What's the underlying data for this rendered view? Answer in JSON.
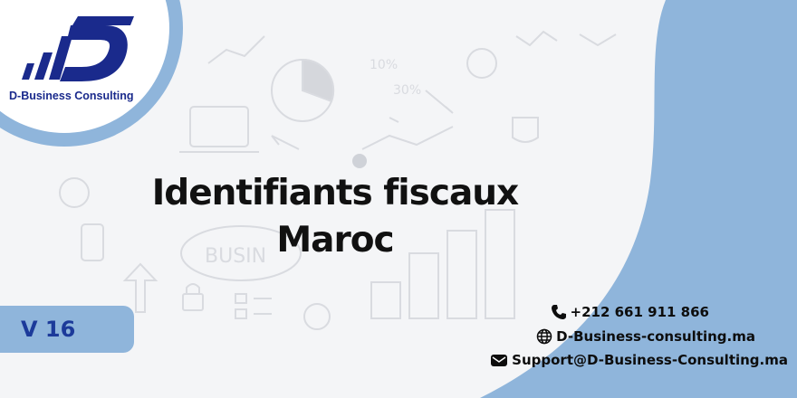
{
  "brand": {
    "name": "D-Business Consulting",
    "colors": {
      "navy": "#1a2a8c",
      "light_blue": "#8fb5db",
      "accent": "#1c3a9a"
    }
  },
  "title": {
    "line1": "Identifiants fiscaux",
    "line2": "Maroc"
  },
  "version": "V 16",
  "background_words": [
    "10%",
    "30%",
    "BUSIN"
  ],
  "contacts": {
    "phone": "+212 661 911 866",
    "website": "D-Business-consulting.ma",
    "email": "Support@D-Business-Consulting.ma"
  },
  "icons": [
    "phone-icon",
    "globe-icon",
    "mail-icon"
  ]
}
